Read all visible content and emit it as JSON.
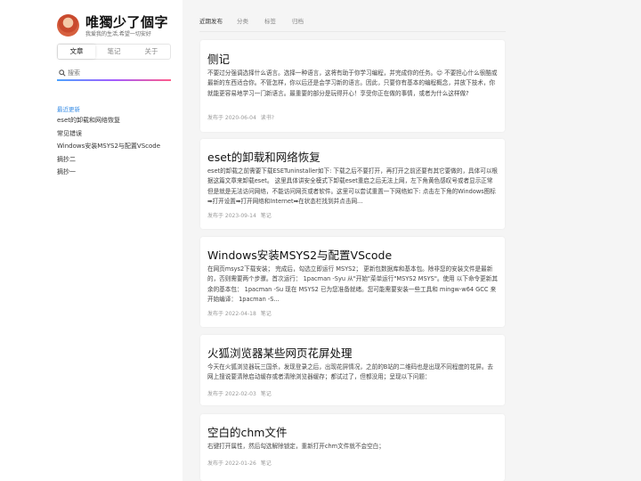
{
  "profile": {
    "title": "唯獨少了個字",
    "subtitle": "我爱我的生活,希望一切安好"
  },
  "sidebar_tabs": [
    "文章",
    "笔记",
    "关于"
  ],
  "search": {
    "placeholder": "搜索"
  },
  "recent": {
    "heading": "最近更新",
    "items": [
      "eset的卸载和网络恢复",
      "常见错误",
      "Windows安装MSYS2与配置VScode",
      "摘抄二",
      "摘抄一"
    ]
  },
  "topnav": [
    "近期发布",
    "分类",
    "标签",
    "归档"
  ],
  "posts": [
    {
      "title": "侧记",
      "excerpt": "不要过分强调选择什么语言。选择一种语言，这将有助于你学习编程，并完成你的任务。😊 不要担心什么很酷或最新的东西适合你。不管怎样，你以后还是会学习新的语言。因此，只要你有基本的编程概念，并放下技术，你就能更容易地学习一门新语言。最重要的部分是玩得开心！享受你正在做的事情，或者为什么这样做?",
      "date": "发布于 2020-06-04",
      "category": "读书?"
    },
    {
      "title": "eset的卸载和网络恢复",
      "excerpt": "eset的卸载之前需要下载ESETuninstaller如下: 下载之后不要打开，再打开之前还要有其它要做的，具体可以根据这篇文章来卸载eset。 这里具体讲安全模式下卸载eset重启之后无法上网，左下角黄色感叹号或者显示正常但是就是无法访问网络，不能访问网页或者软件。这里可以尝试重置一下网络如下:  点击左下角的Windows图标➡打开设置➡打开网络和Internet➡在状态栏找到并点击网...",
      "date": "发布于 2023-09-14",
      "category": "笔记"
    },
    {
      "title": "Windows安装MSYS2与配置VScode",
      "excerpt": "在网页msys2下载安装；  完成后，勾选立即运行 MSYS2；  更新包数据库和基本包。除非您的安装文件是最新的，否则需要两个步骤。首次运行：  1pacman -Syu 从\"开始\"菜单运行\"MSYS2 MSYS\"。使用 以下命令更新其余的基本包：  1pacman -Su 现在 MSYS2 已为您准备就绪。您可能需要安装一些工具和 mingw-w64 GCC 来开始编译：  1pacman -S...",
      "date": "发布于 2022-04-18",
      "category": "笔记"
    },
    {
      "title": "火狐浏览器某些网页花屏处理",
      "excerpt": "今天在火狐浏览器玩三国杀，发现登录之后，出现花屏情况，之前的B站的二维码也是出现不同程度的花屏。去网上搜说要清除启动缓存或者清除浏览器缓存；都试过了，但都没用；呈现以下问题：",
      "date": "发布于 2022-02-03",
      "category": "笔记"
    },
    {
      "title": "空白的chm文件",
      "excerpt": "右键打开属性，然后勾选解除锁定，重新打开chm文件就不会空白；",
      "date": "发布于 2022-01-26",
      "category": "笔记"
    }
  ]
}
